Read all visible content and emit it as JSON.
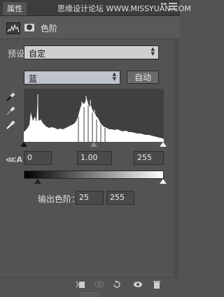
{
  "tabs": {
    "properties": "属性"
  },
  "watermark": "思缘设计论坛  WWW.MISSYUAN.COM",
  "panel": {
    "title": "色阶"
  },
  "preset": {
    "label": "预设：",
    "value": "自定"
  },
  "channel": {
    "value": "蓝"
  },
  "auto_button": "自动",
  "input_levels": {
    "black": "0",
    "gamma": "1.00",
    "white": "255"
  },
  "output_levels": {
    "label": "输出色阶：",
    "black": "25",
    "white": "255"
  },
  "icons": {
    "adjustment": "levels-icon",
    "mask": "mask-icon",
    "droppers": [
      "black-eyedropper-icon",
      "gray-eyedropper-icon",
      "white-eyedropper-icon"
    ],
    "clipping": "clipping-warning-icon",
    "footer": [
      "clip-to-layer-icon",
      "view-previous-state-icon",
      "reset-icon",
      "visibility-icon",
      "delete-icon"
    ]
  },
  "colors": {
    "panel_bg": "#535353",
    "histogram_bg": "#404040",
    "histogram_fill": "#ffffff"
  }
}
